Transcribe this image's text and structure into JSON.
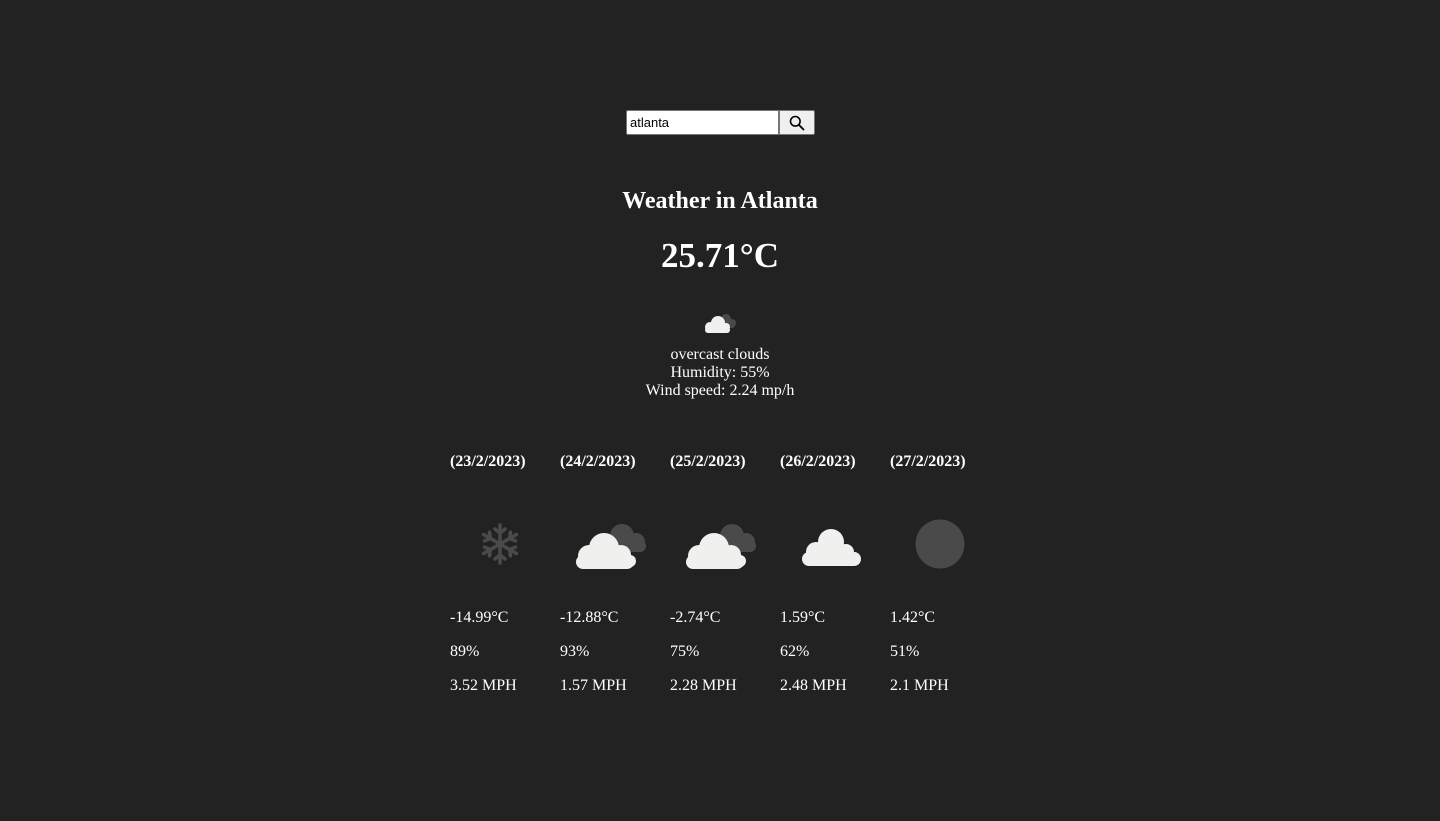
{
  "search": {
    "value": "atlanta",
    "button_icon": "search-icon"
  },
  "current": {
    "title": "Weather in Atlanta",
    "temperature": "25.71°C",
    "icon": "overcast-clouds-icon",
    "description": "overcast clouds",
    "humidity": "Humidity: 55%",
    "wind": "Wind speed: 2.24 mp/h"
  },
  "forecast": [
    {
      "date": "(23/2/2023)",
      "icon": "snow-icon",
      "temp": "-14.99°C",
      "humidity": "89%",
      "wind": "3.52 MPH"
    },
    {
      "date": "(24/2/2023)",
      "icon": "overcast-clouds-icon",
      "temp": "-12.88°C",
      "humidity": "93%",
      "wind": "1.57 MPH"
    },
    {
      "date": "(25/2/2023)",
      "icon": "overcast-clouds-icon",
      "temp": "-2.74°C",
      "humidity": "75%",
      "wind": "2.28 MPH"
    },
    {
      "date": "(26/2/2023)",
      "icon": "cloud-icon",
      "temp": "1.59°C",
      "humidity": "62%",
      "wind": "2.48 MPH"
    },
    {
      "date": "(27/2/2023)",
      "icon": "mist-icon",
      "temp": "1.42°C",
      "humidity": "51%",
      "wind": "2.1 MPH"
    }
  ],
  "colors": {
    "background": "#222222",
    "text": "#ffffff",
    "cloud_light": "#f0f0ee",
    "cloud_dark": "#4a4a4a"
  }
}
